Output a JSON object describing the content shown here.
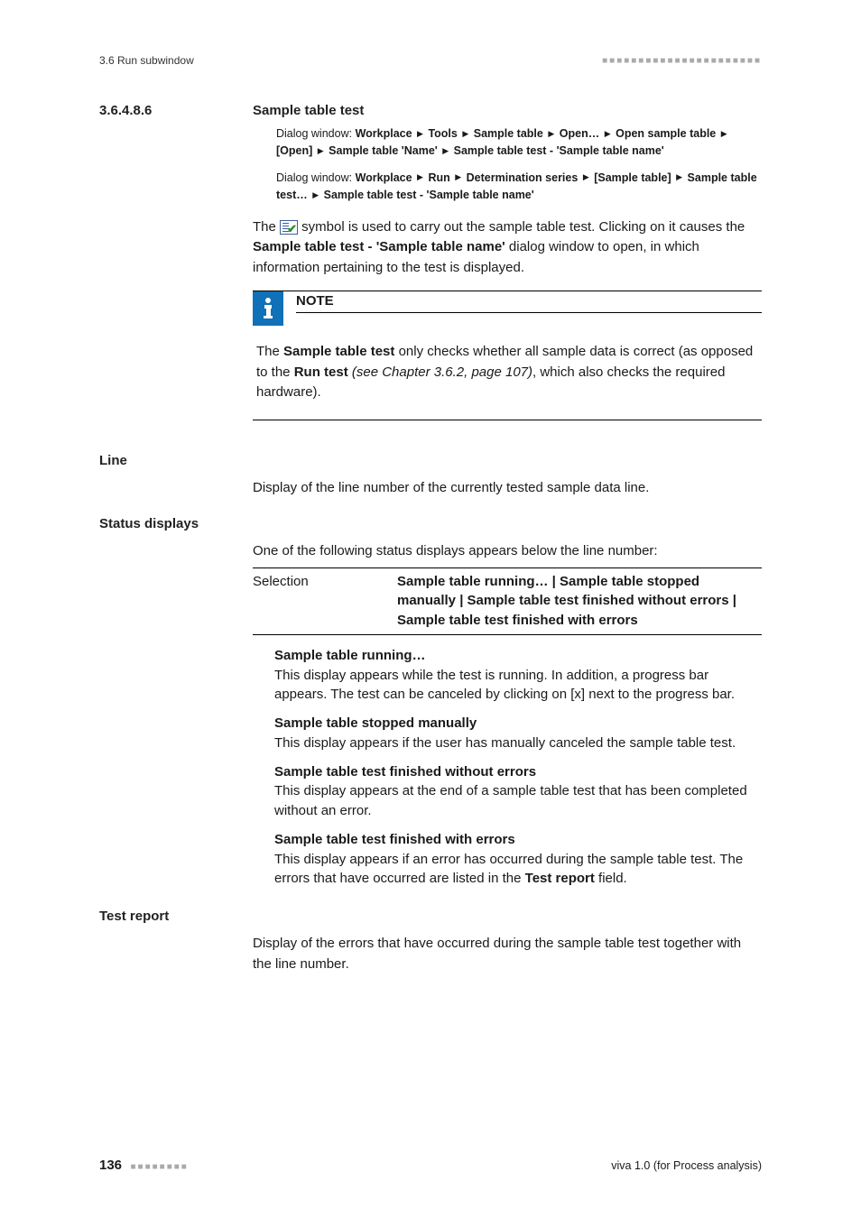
{
  "header": {
    "left": "3.6 Run subwindow"
  },
  "section": {
    "number": "3.6.4.8.6",
    "title": "Sample table test"
  },
  "dialog1": {
    "prefix": "Dialog window:",
    "parts": [
      "Workplace",
      "Tools",
      "Sample table",
      "Open…",
      "Open sample table",
      "[Open]",
      "Sample table 'Name'",
      "Sample table test - 'Sample table name'"
    ]
  },
  "dialog2": {
    "prefix": "Dialog window:",
    "parts": [
      "Workplace",
      "Run",
      "Determination series",
      "[Sample table]",
      "Sample table test…",
      "Sample table test - 'Sample table name'"
    ]
  },
  "intro": {
    "p1a": "The ",
    "p1b": " symbol is used to carry out the sample table test. Clicking on it causes the ",
    "p1c": "Sample table test - 'Sample table name'",
    "p1d": " dialog window to open, in which information pertaining to the test is displayed."
  },
  "note": {
    "title": "NOTE",
    "a": "The ",
    "b": "Sample table test",
    "c": " only checks whether all sample data is correct (as opposed to the ",
    "d": "Run test",
    "e": " (see Chapter 3.6.2, page 107)",
    "f": ", which also checks the required hardware)."
  },
  "line": {
    "label": "Line",
    "text": "Display of the line number of the currently tested sample data line."
  },
  "status": {
    "label": "Status displays",
    "intro": "One of the following status displays appears below the line number:",
    "sel_label": "Selection",
    "sel_value": "Sample table running… | Sample table stopped manually | Sample table test finished without errors | Sample table test finished with errors"
  },
  "defs": [
    {
      "term": "Sample table running…",
      "desc": "This display appears while the test is running. In addition, a progress bar appears. The test can be canceled by clicking on [x] next to the progress bar."
    },
    {
      "term": "Sample table stopped manually",
      "desc": "This display appears if the user has manually canceled the sample table test."
    },
    {
      "term": "Sample table test finished without errors",
      "desc": "This display appears at the end of a sample table test that has been completed without an error."
    },
    {
      "term": "Sample table test finished with errors",
      "desc_a": "This display appears if an error has occurred during the sample table test. The errors that have occurred are listed in the ",
      "desc_b": "Test report",
      "desc_c": " field."
    }
  ],
  "report": {
    "label": "Test report",
    "text": "Display of the errors that have occurred during the sample table test together with the line number."
  },
  "footer": {
    "page": "136",
    "right": "viva 1.0 (for Process analysis)"
  }
}
